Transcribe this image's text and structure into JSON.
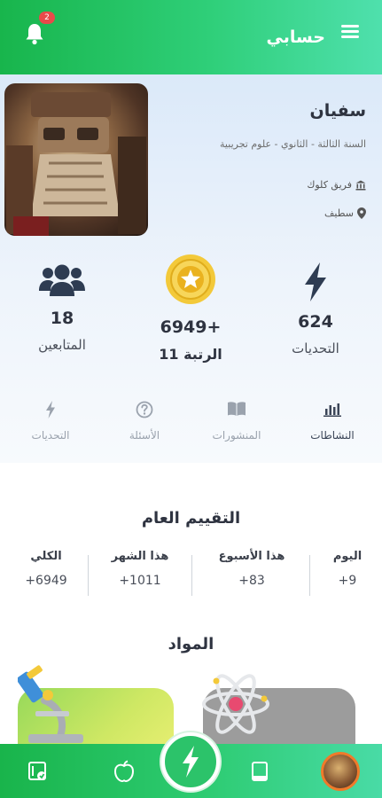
{
  "header": {
    "title": "حسابي",
    "notification_count": "2"
  },
  "profile": {
    "name": "سفيان",
    "grade": "السنة الثالثة - الثانوي - علوم تجريبية",
    "team": "فريق كلوك",
    "city": "سطيف"
  },
  "stats": {
    "challenges_value": "624",
    "challenges_label": "التحديات",
    "points_value": "+6949",
    "rank_label": "الرتبة 11",
    "followers_value": "18",
    "followers_label": "المتابعين"
  },
  "tabs": [
    {
      "label": "النشاطات",
      "icon": "bar-chart-icon",
      "active": true
    },
    {
      "label": "المنشورات",
      "icon": "book-icon",
      "active": false
    },
    {
      "label": "الأسئلة",
      "icon": "question-icon",
      "active": false
    },
    {
      "label": "التحديات",
      "icon": "bolt-icon",
      "active": false
    }
  ],
  "rating": {
    "title": "التقييم العام",
    "today_label": "اليوم",
    "today_value": "+9",
    "week_label": "هذا الأسبوع",
    "week_value": "+83",
    "month_label": "هذا الشهر",
    "month_value": "+1011",
    "total_label": "الكلي",
    "total_value": "+6949"
  },
  "subjects": {
    "title": "المواد"
  },
  "colors": {
    "brand_green": "#22bf5c",
    "accent_teal": "#4fe0ad",
    "badge_red": "#e84a4a"
  }
}
